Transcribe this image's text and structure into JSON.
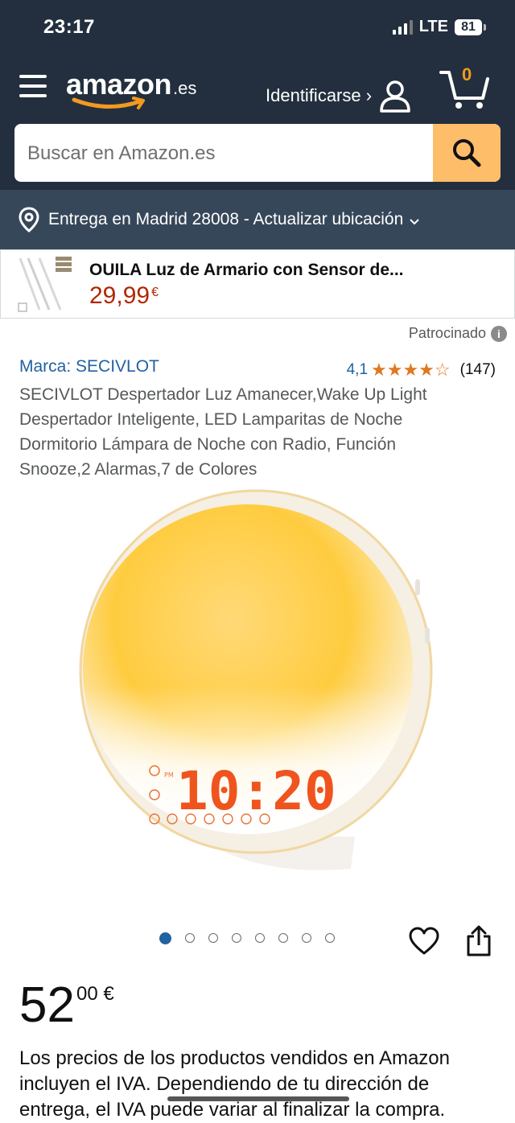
{
  "status_bar": {
    "time": "23:17",
    "network": "LTE",
    "battery": "81"
  },
  "header": {
    "logo_word": "amazon",
    "logo_tld": ".es",
    "signin_label": "Identificarse ›",
    "cart_count": "0"
  },
  "search": {
    "placeholder": "Buscar en Amazon.es"
  },
  "location": {
    "label": "Entrega en Madrid 28008 - Actualizar ubicación"
  },
  "sponsored_banner": {
    "title": "OUILA Luz de Armario con Sensor de...",
    "price": "29,99",
    "currency": "€"
  },
  "sponsored_label": "Patrocinado",
  "product": {
    "brand": "Marca: SECIVLOT",
    "rating_value": "4,1",
    "rating_stars": "★★★★☆",
    "rating_count": "(147)",
    "title": "SECIVLOT Despertador Luz Amanecer,Wake Up Light Despertador Inteligente, LED Lamparitas de Noche Dormitorio Lámpara de Noche con Radio, Función Snooze,2 Alarmas,7 de Colores",
    "clock_display": "10:20",
    "clock_pm": "PM",
    "image_count": 8,
    "active_image": 0,
    "price_whole": "52",
    "price_fraction": "00 €"
  },
  "vat_notice": {
    "part1": "Los precios de los productos vendidos en Amazon incluyen el IVA. ",
    "link": "Dependiendo de tu dirección de entrega, el IVA puede variar al finalizar la compra."
  },
  "colors": {
    "header_bg": "#232f3e",
    "location_bg": "#37475a",
    "search_button": "#febd69",
    "link_blue": "#2162a1",
    "price_red": "#b12704",
    "star_orange": "#de7921"
  }
}
